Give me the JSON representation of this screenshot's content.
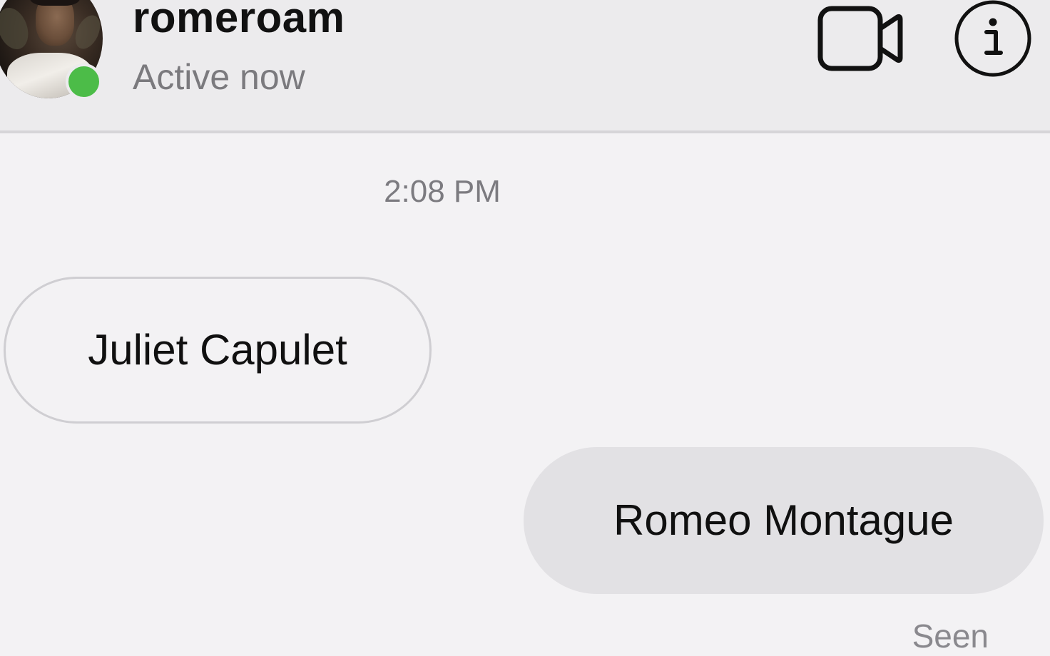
{
  "header": {
    "username": "romeroam",
    "status": "Active now",
    "video_call_icon": "video-camera-icon",
    "info_icon": "info-icon",
    "presence_color": "#4cbc48"
  },
  "thread": {
    "timestamp": "2:08 PM",
    "messages": [
      {
        "direction": "incoming",
        "text": "Juliet Capulet"
      },
      {
        "direction": "outgoing",
        "text": "Romeo Montague"
      }
    ],
    "read_receipt": "Seen"
  }
}
